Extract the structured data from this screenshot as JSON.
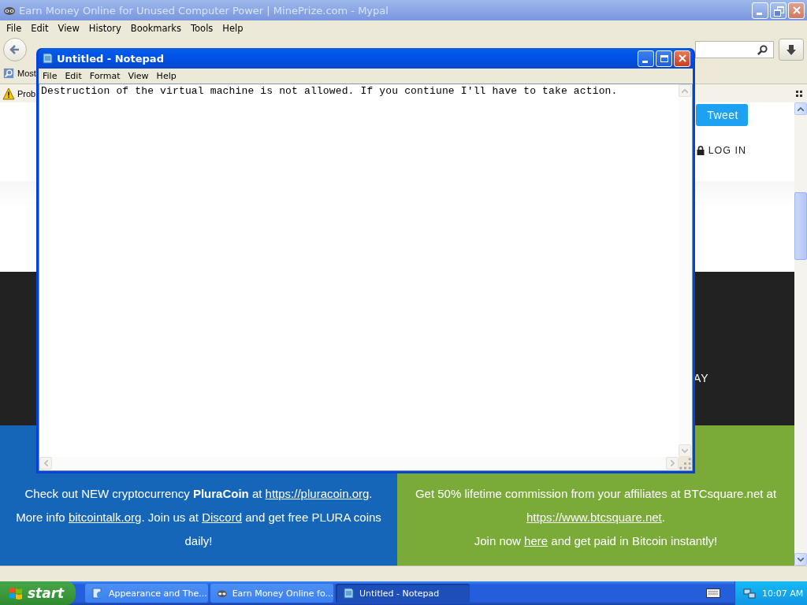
{
  "browser": {
    "title": "Earn Money Online for Unused Computer Power | MinePrize.com - Mypal",
    "active": false,
    "menu": [
      "File",
      "Edit",
      "View",
      "History",
      "Bookmarks",
      "Tools",
      "Help"
    ],
    "bookmarks_bar": {
      "item": "Most"
    },
    "notification_bar": {
      "text": "Prob"
    },
    "page": {
      "tweet_button": "Tweet",
      "login_link": "LOG IN",
      "banner_text": "AY",
      "footer_left": [
        {
          "kind": "text",
          "text": "Check out NEW cryptocurrency "
        },
        {
          "kind": "bold",
          "text": "PluraCoin"
        },
        {
          "kind": "text",
          "text": " at "
        },
        {
          "kind": "link",
          "text": "https://pluracoin.org"
        },
        {
          "kind": "text",
          "text": ". More info "
        },
        {
          "kind": "link",
          "text": "bitcointalk.org"
        },
        {
          "kind": "text",
          "text": ". Join us at "
        },
        {
          "kind": "link",
          "text": "Discord"
        },
        {
          "kind": "text",
          "text": " and get free PLURA coins daily!"
        }
      ],
      "footer_right": [
        [
          {
            "kind": "text",
            "text": "Get 50% lifetime commission from your affiliates at BTCsquare.net at "
          },
          {
            "kind": "link",
            "text": "https://www.btcsquare.net"
          },
          {
            "kind": "text",
            "text": "."
          }
        ],
        [
          {
            "kind": "text",
            "text": "Join now "
          },
          {
            "kind": "link",
            "text": "here"
          },
          {
            "kind": "text",
            "text": " and get paid in Bitcoin instantly!"
          }
        ]
      ]
    }
  },
  "notepad": {
    "title": "Untitled - Notepad",
    "active": true,
    "menu": [
      "File",
      "Edit",
      "Format",
      "View",
      "Help"
    ],
    "text": "Destruction of the virtual machine is not allowed. If you contiune I'll have to take action."
  },
  "taskbar": {
    "start": "start",
    "tasks": [
      {
        "kind": "control-panel",
        "label": "Appearance and The...",
        "selected": false
      },
      {
        "kind": "browser",
        "label": "Earn Money Online fo...",
        "selected": false
      },
      {
        "kind": "notepad",
        "label": "Untitled - Notepad",
        "selected": true
      }
    ],
    "clock": "10:07 AM"
  }
}
